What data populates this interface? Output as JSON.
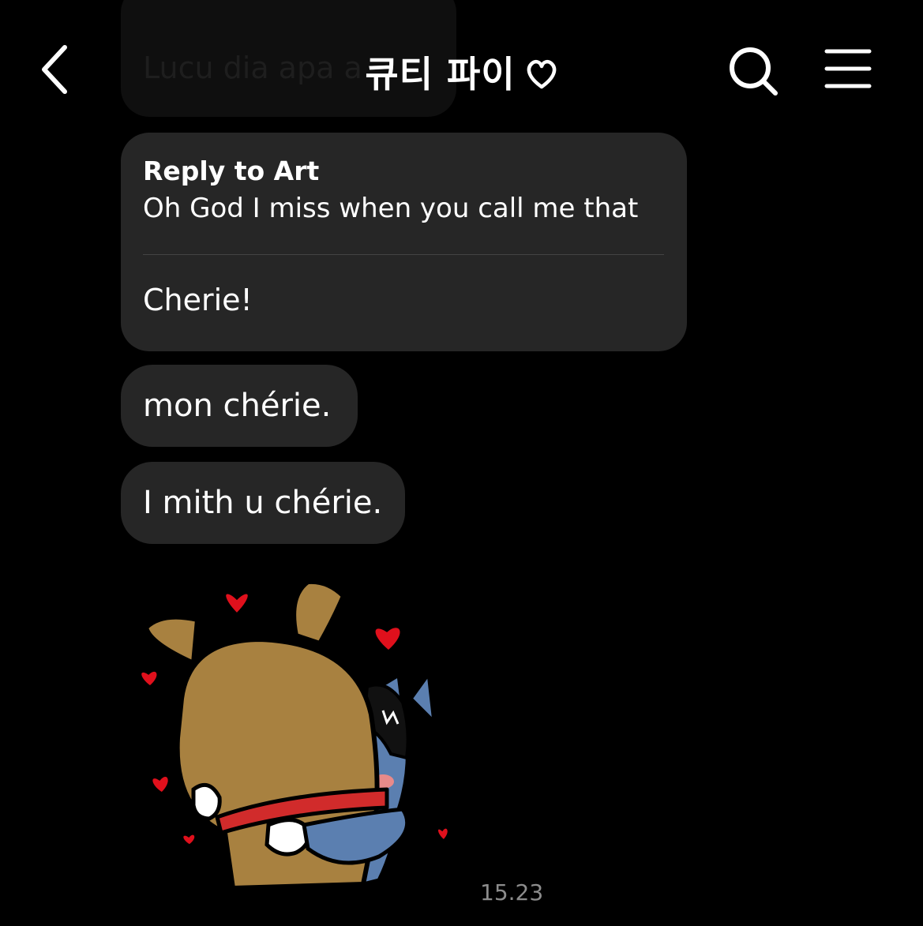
{
  "header": {
    "title": "큐티 파이",
    "back_icon": "chevron-left-icon",
    "search_icon": "search-icon",
    "menu_icon": "hamburger-menu-icon",
    "title_icon": "heart-outline-icon"
  },
  "messages": {
    "partial_previous": "Lucu dia apa a",
    "reply": {
      "label": "Reply to Art",
      "quoted_text": "Oh God I miss when you call me that",
      "text": "Cherie!"
    },
    "items": [
      {
        "text": "mon chérie."
      },
      {
        "text": "I mith u chérie."
      }
    ],
    "sticker": "hugging-characters-sticker",
    "timestamp": "15.23"
  },
  "colors": {
    "background": "#000000",
    "bubble": "#262626",
    "text": "#ffffff",
    "timestamp": "#8c8c8c",
    "heart": "#e0101c"
  }
}
